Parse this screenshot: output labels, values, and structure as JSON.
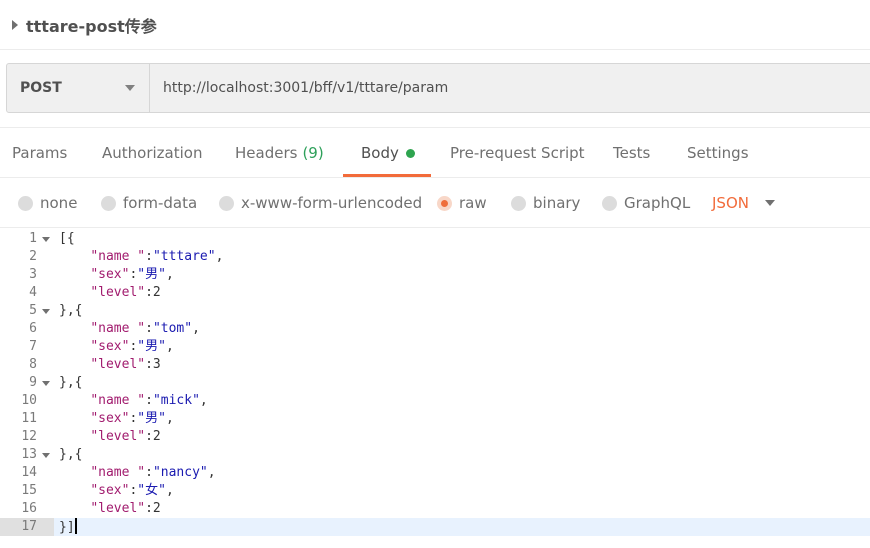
{
  "request": {
    "title": "tttare-post传参",
    "method": "POST",
    "url": "http://localhost:3001/bff/v1/tttare/param"
  },
  "tabs": {
    "params": "Params",
    "authorization": "Authorization",
    "headers": "Headers",
    "headers_count": "(9)",
    "body": "Body",
    "prerequest": "Pre-request Script",
    "tests": "Tests",
    "settings": "Settings"
  },
  "body_types": {
    "none": "none",
    "form_data": "form-data",
    "urlencoded": "x-www-form-urlencoded",
    "raw": "raw",
    "binary": "binary",
    "graphql": "GraphQL",
    "format": "JSON",
    "selected": "raw"
  },
  "editor": {
    "current_line": 17,
    "lines": [
      "[{",
      "    \"name \":\"tttare\",",
      "    \"sex\":\"男\",",
      "    \"level\":2",
      "},{",
      "    \"name \":\"tom\",",
      "    \"sex\":\"男\",",
      "    \"level\":3",
      "},{",
      "    \"name \":\"mick\",",
      "    \"sex\":\"男\",",
      "    \"level\":2",
      "},{",
      "    \"name \":\"nancy\",",
      "    \"sex\":\"女\",",
      "    \"level\":2",
      "}]"
    ],
    "foldable_lines": [
      1,
      5,
      9,
      13
    ]
  },
  "colors": {
    "accent": "#f26b3a",
    "status_dot": "#2ea44f",
    "json_key": "#a11b6e",
    "json_string": "#1a1ab0"
  }
}
